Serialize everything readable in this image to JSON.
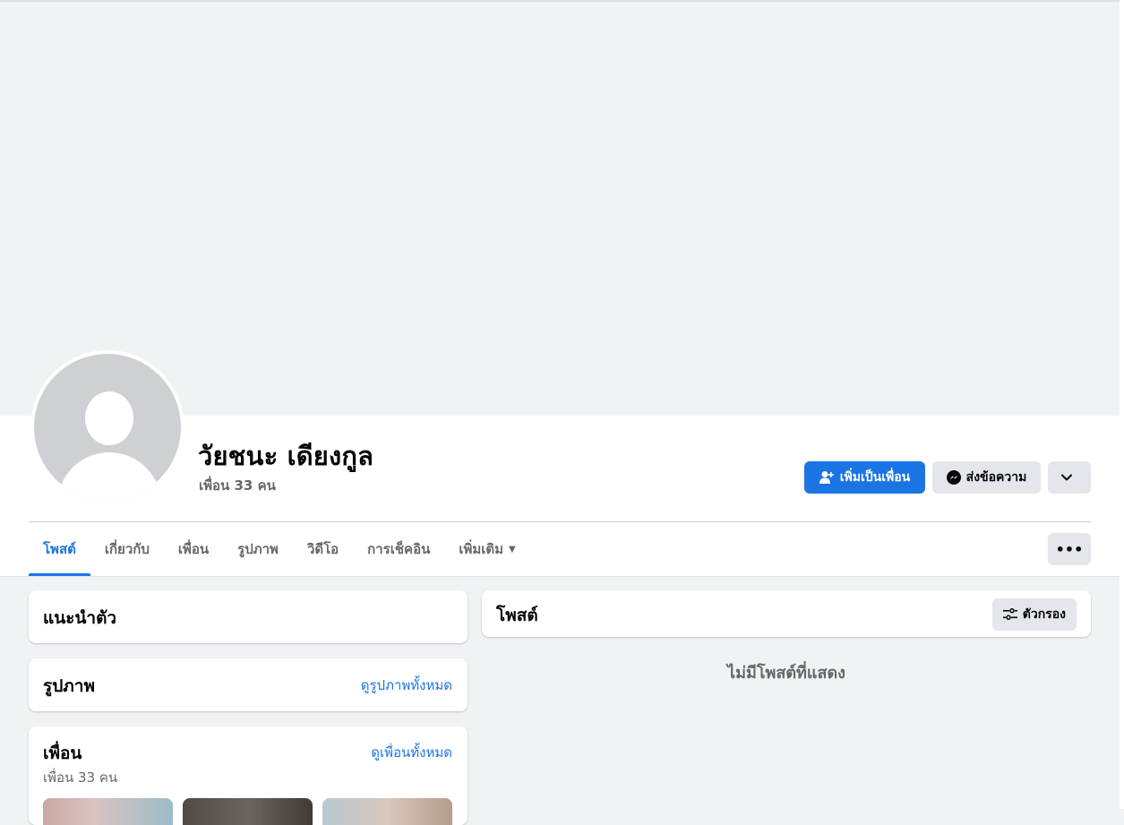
{
  "profile": {
    "name": "วัยชนะ เดียงกูล",
    "friend_count": "เพื่อน 33 คน"
  },
  "actions": {
    "add_friend": "เพิ่มเป็นเพื่อน",
    "message": "ส่งข้อความ"
  },
  "tabs": [
    {
      "label": "โพสต์",
      "active": true
    },
    {
      "label": "เกี่ยวกับ",
      "active": false
    },
    {
      "label": "เพื่อน",
      "active": false
    },
    {
      "label": "รูปภาพ",
      "active": false
    },
    {
      "label": "วิดีโอ",
      "active": false
    },
    {
      "label": "การเช็คอิน",
      "active": false
    },
    {
      "label": "เพิ่มเติม",
      "active": false
    }
  ],
  "intro": {
    "title": "แนะนำตัว"
  },
  "photos": {
    "title": "รูปภาพ",
    "see_all": "ดูรูปภาพทั้งหมด"
  },
  "friends": {
    "title": "เพื่อน",
    "see_all": "ดูเพื่อนทั้งหมด",
    "count": "เพื่อน 33 คน"
  },
  "posts": {
    "title": "โพสต์",
    "filter": "ตัวกรอง",
    "empty": "ไม่มีโพสต์ที่แสดง"
  },
  "colors": {
    "accent": "#1b74e4",
    "page_bg": "#f0f2f5",
    "secondary_button": "#e4e6eb"
  }
}
